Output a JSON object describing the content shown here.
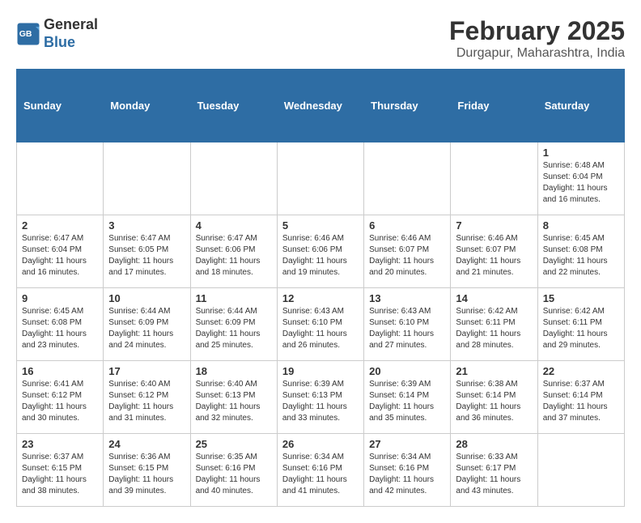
{
  "header": {
    "logo_line1": "General",
    "logo_line2": "Blue",
    "month": "February 2025",
    "location": "Durgapur, Maharashtra, India"
  },
  "weekdays": [
    "Sunday",
    "Monday",
    "Tuesday",
    "Wednesday",
    "Thursday",
    "Friday",
    "Saturday"
  ],
  "weeks": [
    [
      {
        "day": "",
        "info": ""
      },
      {
        "day": "",
        "info": ""
      },
      {
        "day": "",
        "info": ""
      },
      {
        "day": "",
        "info": ""
      },
      {
        "day": "",
        "info": ""
      },
      {
        "day": "",
        "info": ""
      },
      {
        "day": "1",
        "info": "Sunrise: 6:48 AM\nSunset: 6:04 PM\nDaylight: 11 hours\nand 16 minutes."
      }
    ],
    [
      {
        "day": "2",
        "info": "Sunrise: 6:47 AM\nSunset: 6:04 PM\nDaylight: 11 hours\nand 16 minutes."
      },
      {
        "day": "3",
        "info": "Sunrise: 6:47 AM\nSunset: 6:05 PM\nDaylight: 11 hours\nand 17 minutes."
      },
      {
        "day": "4",
        "info": "Sunrise: 6:47 AM\nSunset: 6:06 PM\nDaylight: 11 hours\nand 18 minutes."
      },
      {
        "day": "5",
        "info": "Sunrise: 6:46 AM\nSunset: 6:06 PM\nDaylight: 11 hours\nand 19 minutes."
      },
      {
        "day": "6",
        "info": "Sunrise: 6:46 AM\nSunset: 6:07 PM\nDaylight: 11 hours\nand 20 minutes."
      },
      {
        "day": "7",
        "info": "Sunrise: 6:46 AM\nSunset: 6:07 PM\nDaylight: 11 hours\nand 21 minutes."
      },
      {
        "day": "8",
        "info": "Sunrise: 6:45 AM\nSunset: 6:08 PM\nDaylight: 11 hours\nand 22 minutes."
      }
    ],
    [
      {
        "day": "9",
        "info": "Sunrise: 6:45 AM\nSunset: 6:08 PM\nDaylight: 11 hours\nand 23 minutes."
      },
      {
        "day": "10",
        "info": "Sunrise: 6:44 AM\nSunset: 6:09 PM\nDaylight: 11 hours\nand 24 minutes."
      },
      {
        "day": "11",
        "info": "Sunrise: 6:44 AM\nSunset: 6:09 PM\nDaylight: 11 hours\nand 25 minutes."
      },
      {
        "day": "12",
        "info": "Sunrise: 6:43 AM\nSunset: 6:10 PM\nDaylight: 11 hours\nand 26 minutes."
      },
      {
        "day": "13",
        "info": "Sunrise: 6:43 AM\nSunset: 6:10 PM\nDaylight: 11 hours\nand 27 minutes."
      },
      {
        "day": "14",
        "info": "Sunrise: 6:42 AM\nSunset: 6:11 PM\nDaylight: 11 hours\nand 28 minutes."
      },
      {
        "day": "15",
        "info": "Sunrise: 6:42 AM\nSunset: 6:11 PM\nDaylight: 11 hours\nand 29 minutes."
      }
    ],
    [
      {
        "day": "16",
        "info": "Sunrise: 6:41 AM\nSunset: 6:12 PM\nDaylight: 11 hours\nand 30 minutes."
      },
      {
        "day": "17",
        "info": "Sunrise: 6:40 AM\nSunset: 6:12 PM\nDaylight: 11 hours\nand 31 minutes."
      },
      {
        "day": "18",
        "info": "Sunrise: 6:40 AM\nSunset: 6:13 PM\nDaylight: 11 hours\nand 32 minutes."
      },
      {
        "day": "19",
        "info": "Sunrise: 6:39 AM\nSunset: 6:13 PM\nDaylight: 11 hours\nand 33 minutes."
      },
      {
        "day": "20",
        "info": "Sunrise: 6:39 AM\nSunset: 6:14 PM\nDaylight: 11 hours\nand 35 minutes."
      },
      {
        "day": "21",
        "info": "Sunrise: 6:38 AM\nSunset: 6:14 PM\nDaylight: 11 hours\nand 36 minutes."
      },
      {
        "day": "22",
        "info": "Sunrise: 6:37 AM\nSunset: 6:14 PM\nDaylight: 11 hours\nand 37 minutes."
      }
    ],
    [
      {
        "day": "23",
        "info": "Sunrise: 6:37 AM\nSunset: 6:15 PM\nDaylight: 11 hours\nand 38 minutes."
      },
      {
        "day": "24",
        "info": "Sunrise: 6:36 AM\nSunset: 6:15 PM\nDaylight: 11 hours\nand 39 minutes."
      },
      {
        "day": "25",
        "info": "Sunrise: 6:35 AM\nSunset: 6:16 PM\nDaylight: 11 hours\nand 40 minutes."
      },
      {
        "day": "26",
        "info": "Sunrise: 6:34 AM\nSunset: 6:16 PM\nDaylight: 11 hours\nand 41 minutes."
      },
      {
        "day": "27",
        "info": "Sunrise: 6:34 AM\nSunset: 6:16 PM\nDaylight: 11 hours\nand 42 minutes."
      },
      {
        "day": "28",
        "info": "Sunrise: 6:33 AM\nSunset: 6:17 PM\nDaylight: 11 hours\nand 43 minutes."
      },
      {
        "day": "",
        "info": ""
      }
    ]
  ]
}
